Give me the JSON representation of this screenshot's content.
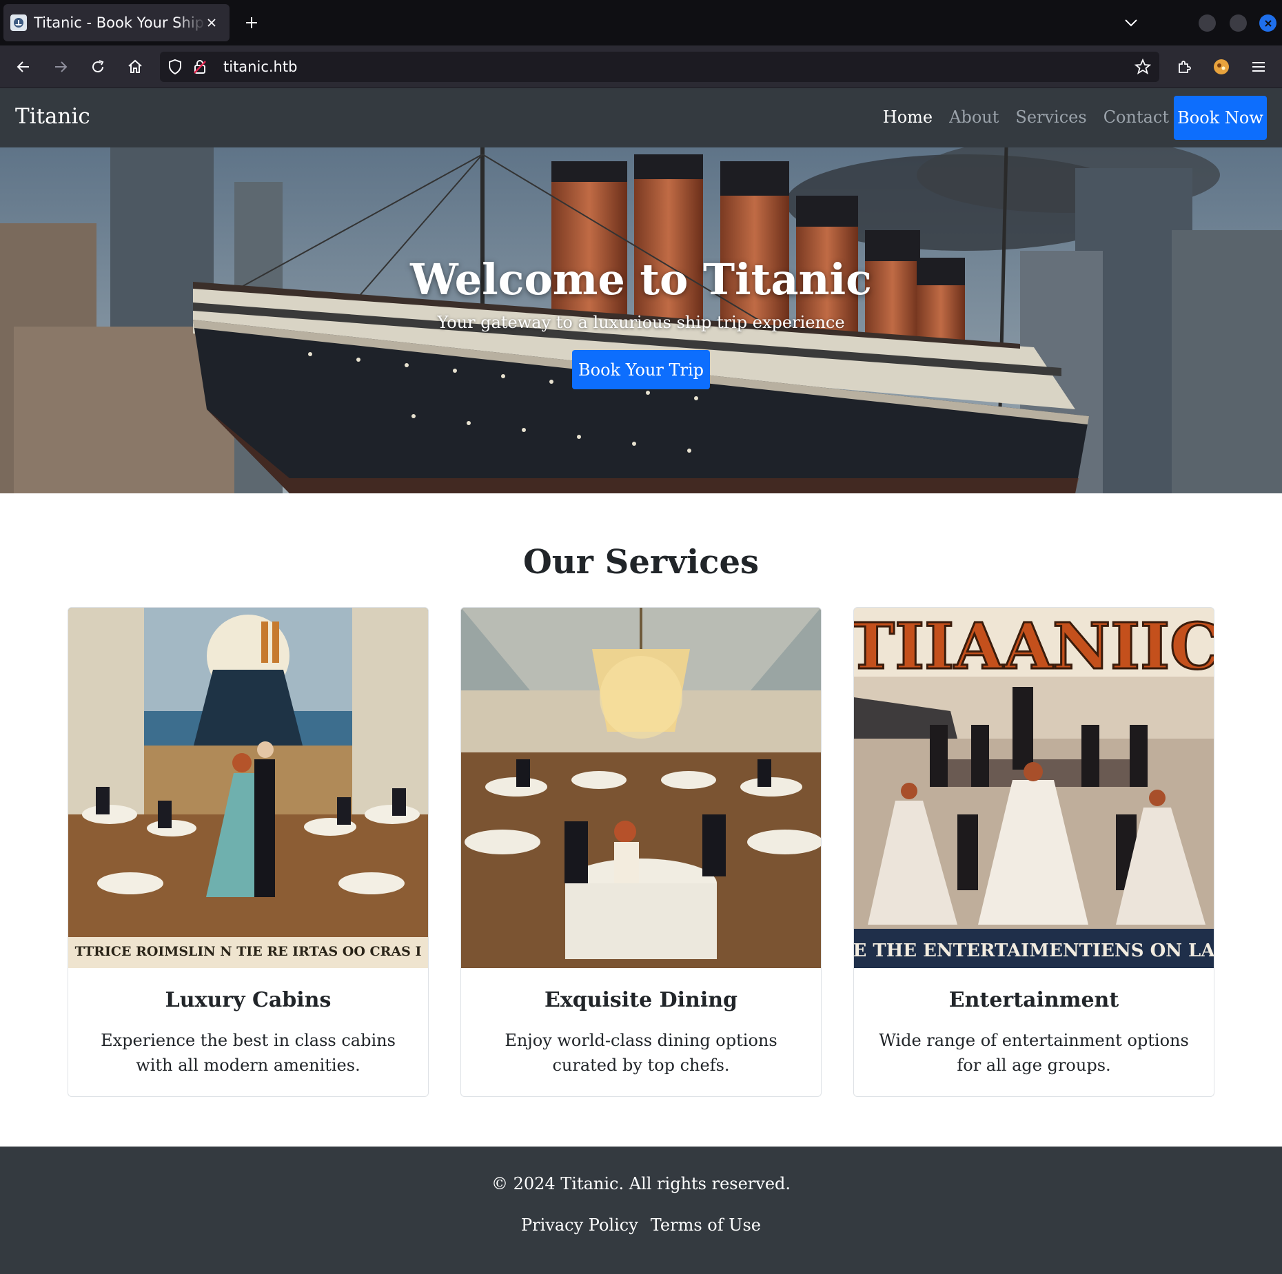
{
  "browser": {
    "tab_title": "Titanic - Book Your Ship Trip",
    "url": "titanic.htb"
  },
  "site": {
    "brand": "Titanic",
    "nav": [
      {
        "label": "Home",
        "active": true
      },
      {
        "label": "About",
        "active": false
      },
      {
        "label": "Services",
        "active": false
      },
      {
        "label": "Contact",
        "active": false
      }
    ],
    "book_now": "Book Now"
  },
  "hero": {
    "title": "Welcome to Titanic",
    "subtitle": "Your gateway to a luxurious ship trip experience",
    "button": "Book Your Trip"
  },
  "services": {
    "title": "Our Services",
    "cards": [
      {
        "title": "Luxury Cabins",
        "text": "Experience the best in class cabins with all modern amenities.",
        "image_caption": "TTRICE ROIMSLIN N TIE RE IRTAS OO CRAS I"
      },
      {
        "title": "Exquisite Dining",
        "text": "Enjoy world-class dining options curated by top chefs.",
        "image_caption": ""
      },
      {
        "title": "Entertainment",
        "text": "Wide range of entertainment options for all age groups.",
        "image_caption": "E THE ENTERTAIMENTIENS ON LA",
        "poster_title": "TIIAANIIC"
      }
    ]
  },
  "footer": {
    "copyright": "© 2024 Titanic. All rights reserved.",
    "links": [
      "Privacy Policy",
      "Terms of Use"
    ]
  },
  "colors": {
    "primary": "#0d6efd",
    "dark": "#343a40",
    "browser_bg": "#2b2a33",
    "tabstrip_bg": "#0f0f13"
  }
}
